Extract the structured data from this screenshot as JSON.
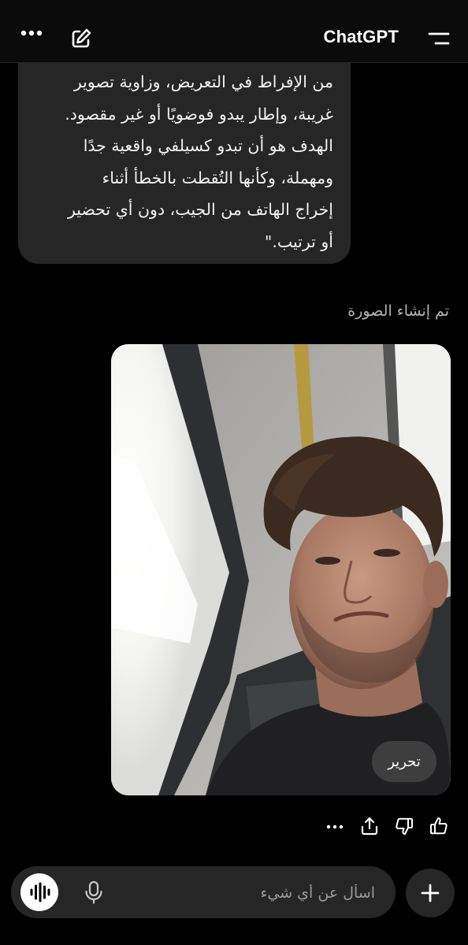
{
  "header": {
    "title": "ChatGPT",
    "more_icon": "ellipsis-icon",
    "new_chat_icon": "pencil-square-icon",
    "menu_icon": "menu-icon"
  },
  "message": {
    "text": "من الإفراط في التعريض، وزاوية تصوير\nغريبة، وإطار يبدو فوضويًا أو غير مقصود.\nالهدف هو أن تبدو كسيلفي واقعية جدًا\nومهملة، وكأنها التُقطت بالخطأ أثناء\nإخراج الهاتف من الجيب، دون أي تحضير\nأو ترتيب.\""
  },
  "result": {
    "status": "تم إنشاء الصورة",
    "edit_label": "تحرير"
  },
  "actions": {
    "icons": [
      "thumbs-up-icon",
      "thumbs-down-icon",
      "share-icon",
      "more-icon"
    ]
  },
  "composer": {
    "placeholder": "اسأل عن أي شيء",
    "value": "",
    "icons": [
      "voice-mode-icon",
      "microphone-icon",
      "plus-icon"
    ]
  },
  "colors": {
    "background": "#000000",
    "bubble": "#262626",
    "header": "#0b0b0b",
    "muted_text": "#b4b4b4"
  }
}
